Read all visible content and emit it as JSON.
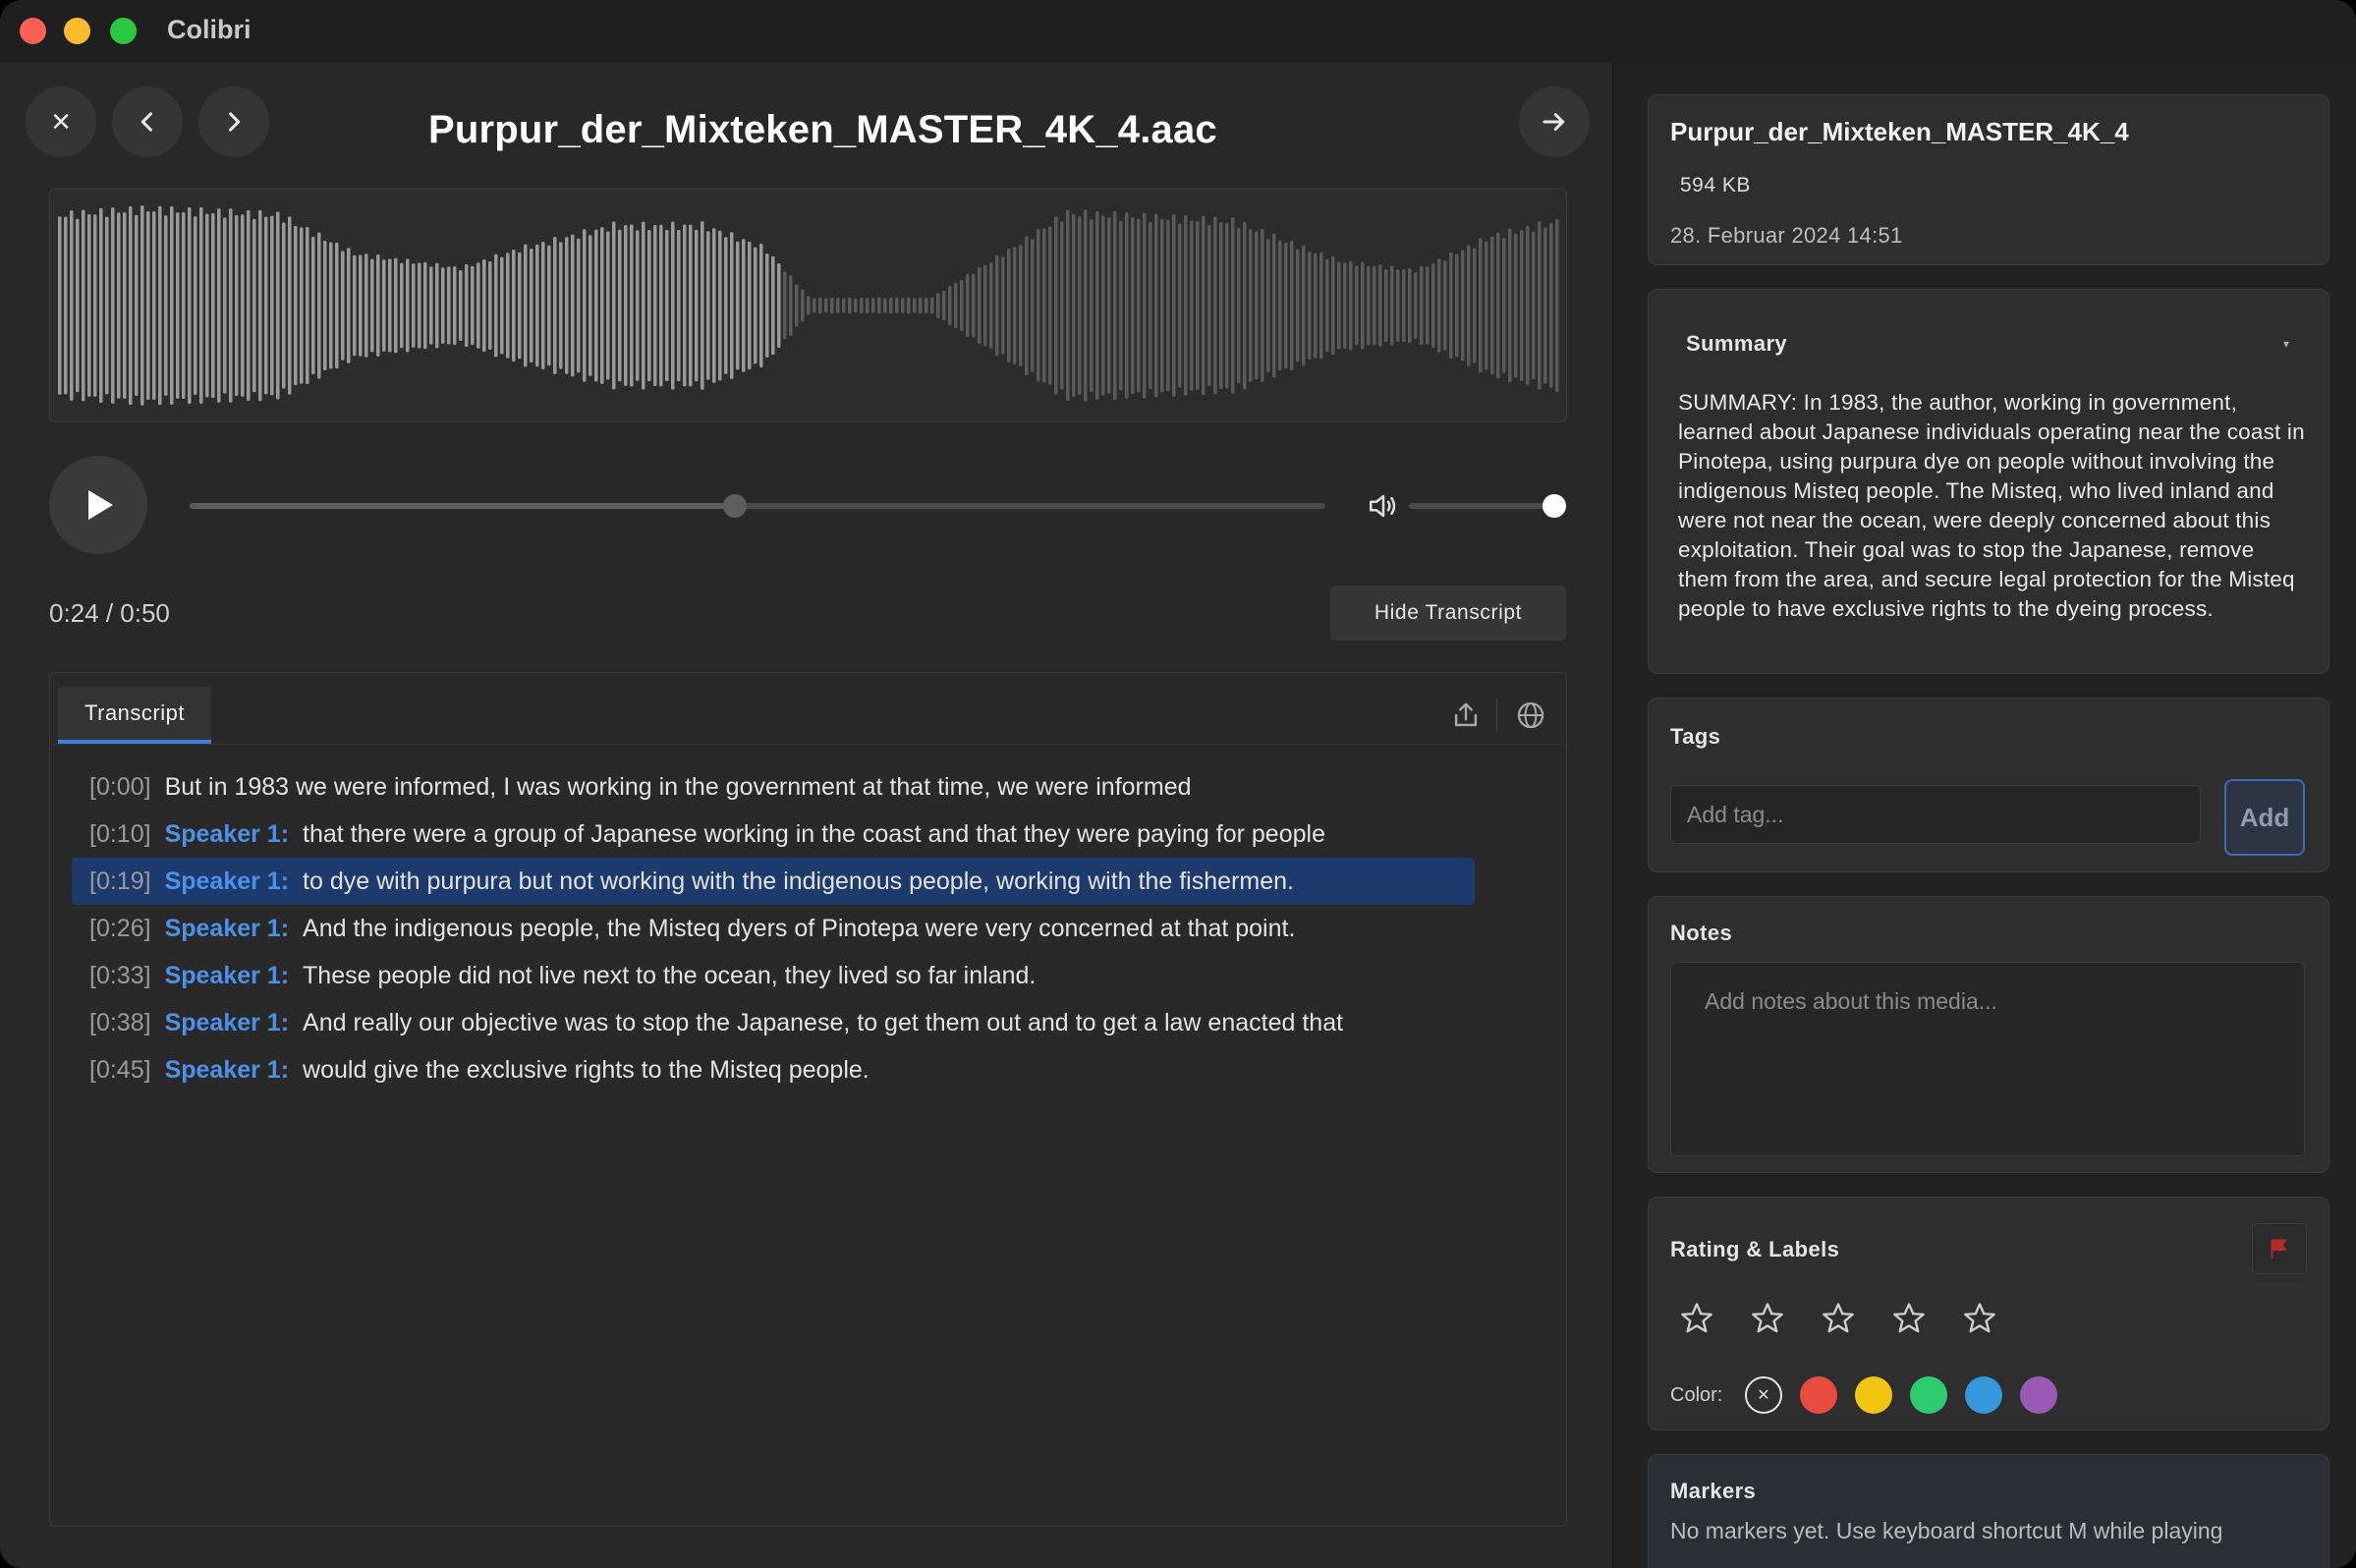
{
  "window": {
    "app_title": "Colibri"
  },
  "header": {
    "file_title": "Purpur_der_Mixteken_MASTER_4K_4.aac",
    "close_glyph": "×",
    "prev_glyph": "‹",
    "next_glyph": "›",
    "forward_glyph": "→"
  },
  "player": {
    "time_display": "0:24 / 0:50",
    "progress": 0.48,
    "volume": 1.0,
    "hide_transcript_label": "Hide Transcript"
  },
  "transcript": {
    "tab_label": "Transcript",
    "active_index": 2,
    "lines": [
      {
        "ts": "[0:00]",
        "speaker": "",
        "text": "But in 1983 we were informed, I was working in the government at that time, we were informed"
      },
      {
        "ts": "[0:10]",
        "speaker": "Speaker 1:",
        "text": "that there were a group of Japanese working in the coast and that they were paying for people"
      },
      {
        "ts": "[0:19]",
        "speaker": "Speaker 1:",
        "text": "to dye with purpura but not working with the indigenous people, working with the fishermen."
      },
      {
        "ts": "[0:26]",
        "speaker": "Speaker 1:",
        "text": "And the indigenous people, the Misteq dyers of Pinotepa were very concerned at that point."
      },
      {
        "ts": "[0:33]",
        "speaker": "Speaker 1:",
        "text": "These people did not live next to the ocean, they lived so far inland."
      },
      {
        "ts": "[0:38]",
        "speaker": "Speaker 1:",
        "text": "And really our objective was to stop the Japanese, to get them out and to get a law enacted that"
      },
      {
        "ts": "[0:45]",
        "speaker": "Speaker 1:",
        "text": "would give the exclusive rights to the Misteq people."
      }
    ]
  },
  "sidebar": {
    "meta": {
      "name": "Purpur_der_Mixteken_MASTER_4K_4",
      "size": "594 KB",
      "date": "28. Februar 2024 14:51"
    },
    "summary": {
      "title": "Summary",
      "text": "SUMMARY: In 1983, the author, working in government, learned about Japanese individuals operating near the coast in Pinotepa, using purpura dye on people without involving the indigenous Misteq people. The Misteq, who lived inland and were not near the ocean, were deeply concerned about this exploitation. Their goal was to stop the Japanese, remove them from the area, and secure legal protection for the Misteq people to have exclusive rights to the dyeing process."
    },
    "tags": {
      "title": "Tags",
      "placeholder": "Add tag...",
      "add_label": "Add"
    },
    "notes": {
      "title": "Notes",
      "placeholder": "Add notes about this media..."
    },
    "rating": {
      "title": "Rating & Labels",
      "stars": 0,
      "star_count": 5,
      "color_label": "Color:",
      "colors": [
        "#e74c3c",
        "#f1c40f",
        "#2ecc71",
        "#3498db",
        "#9b59b6"
      ],
      "flag_color": "#b42b2b"
    },
    "markers": {
      "title": "Markers",
      "empty_text": "No markers yet. Use keyboard shortcut M while playing"
    }
  }
}
